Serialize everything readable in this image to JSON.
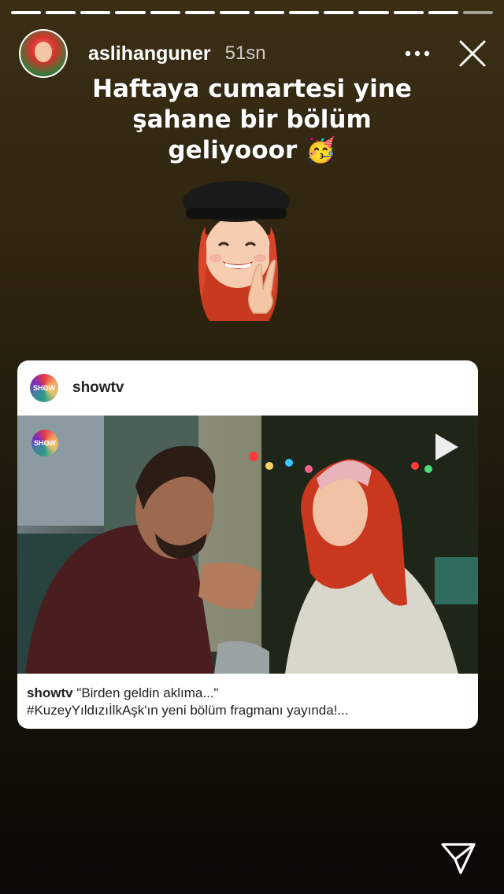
{
  "story": {
    "segments": 14,
    "username": "aslihanguner",
    "timestamp": "51sn",
    "caption_lines": [
      "Haftaya cumartesi yine",
      "şahane bir bölüm",
      "geliyooor 🥳"
    ],
    "sticker": "memoji-peace-sign"
  },
  "post": {
    "account": "showtv",
    "media_badge": "SHOW",
    "caption_user": "showtv",
    "caption_text": " \"Birden geldin aklıma...\"",
    "caption_line2": "#KuzeyYıldızıİlkAşk'ın yeni bölüm fragmanı yayında!..."
  },
  "icons": {
    "more": "more-horizontal-icon",
    "close": "close-icon",
    "send": "send-icon",
    "play": "play-icon"
  },
  "colors": {
    "background_top": "#3a2e15",
    "background_bottom": "#0b0905",
    "card": "#ffffff"
  }
}
